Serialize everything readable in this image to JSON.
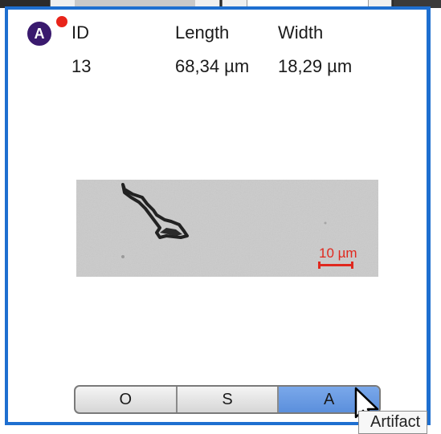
{
  "badge": {
    "letter": "A",
    "color": "#3a1a6e",
    "dot_color": "#e8241a"
  },
  "headers": {
    "id": "ID",
    "length": "Length",
    "width": "Width"
  },
  "record": {
    "id": "13",
    "length": "68,34 µm",
    "width": "18,29 µm"
  },
  "micrograph": {
    "scale_label": "10 µm",
    "scale_color": "#e0281e"
  },
  "classification": {
    "options": [
      "O",
      "S",
      "A"
    ],
    "selected": "A"
  },
  "tooltip": {
    "text": "Artifact"
  },
  "colors": {
    "card_border": "#1e6fd0",
    "active_segment": "#6a9be3"
  }
}
